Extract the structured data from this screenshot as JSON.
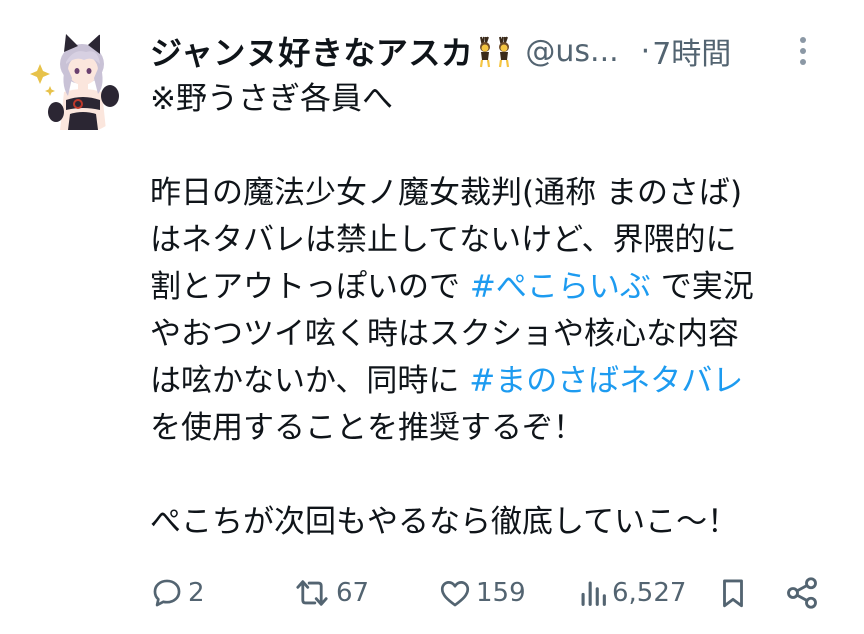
{
  "tweet": {
    "display_name": "ジャンヌ好きなアスカ",
    "handle": "@us...",
    "separator": "·",
    "time": "7時間",
    "body_lines": [
      [
        {
          "t": "※野うさぎ各員へ"
        }
      ],
      [],
      [
        {
          "t": "昨日の魔法少女ノ魔女裁判(通称 まのさば)"
        }
      ],
      [
        {
          "t": "はネタバレは禁止してないけど、界隈的に"
        }
      ],
      [
        {
          "t": "割とアウトっぽいので "
        },
        {
          "t": "#ぺこらいぶ",
          "h": true
        },
        {
          "t": " で実況"
        }
      ],
      [
        {
          "t": "やおつツイ呟く時はスクショや核心な内容"
        }
      ],
      [
        {
          "t": "は呟かないか、同時に "
        },
        {
          "t": "#まのさばネタバレ",
          "h": true
        }
      ],
      [
        {
          "t": "を使用することを推奨するぞ！"
        }
      ],
      [],
      [
        {
          "t": "ぺこちが次回もやるなら徹底していこ〜！"
        }
      ]
    ],
    "metrics": {
      "replies": "2",
      "retweets": "67",
      "likes": "159",
      "views": "6,527"
    }
  },
  "icons": {
    "reply": "speech-bubble-icon",
    "retweet": "retweet-arrows-icon",
    "like": "heart-icon",
    "views": "bar-chart-icon",
    "bookmark": "bookmark-icon",
    "share": "share-icon",
    "more": "vertical-ellipsis-icon",
    "badge": "dancing-bunny-girls-emoji"
  },
  "colors": {
    "text": "#0f1419",
    "secondary": "#536471",
    "link": "#1d9bf0",
    "background": "#ffffff"
  }
}
